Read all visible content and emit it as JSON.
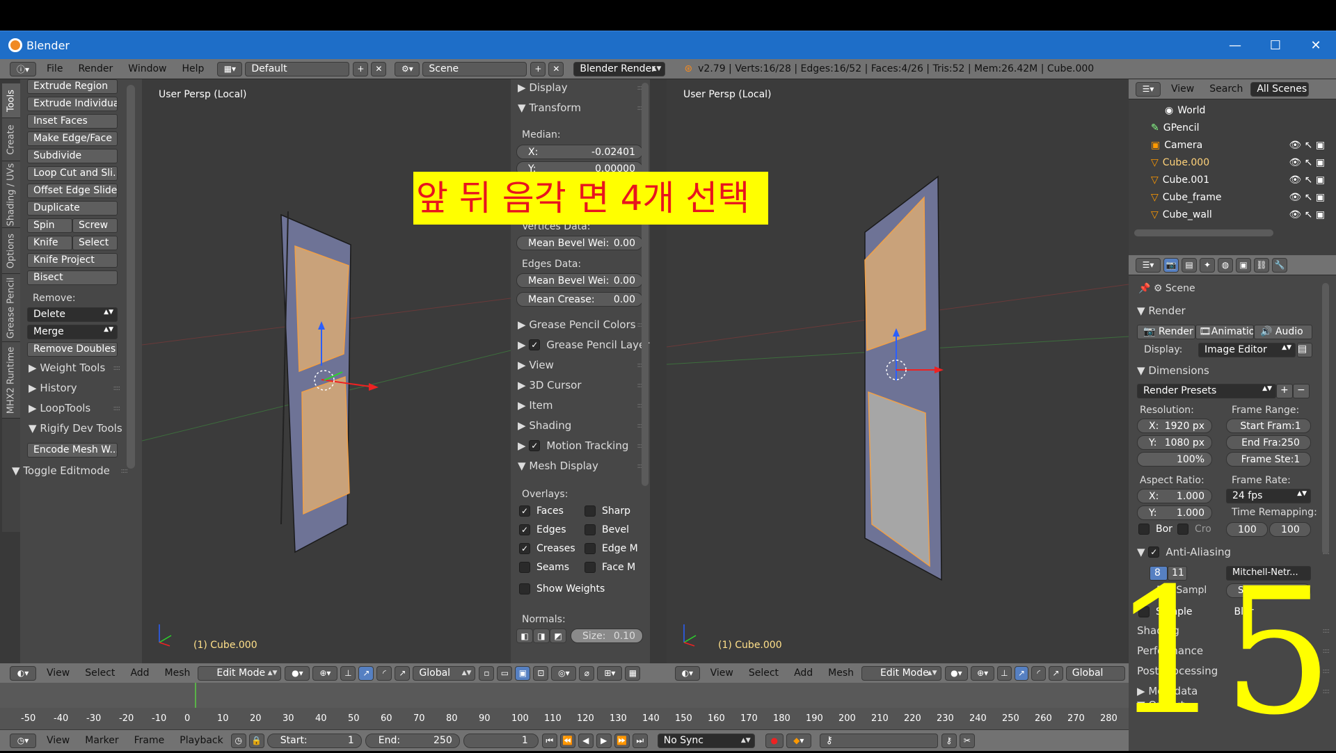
{
  "window": {
    "title": "Blender",
    "minimize": "—",
    "maximize": "☐",
    "close": "✕"
  },
  "info_header": {
    "menus": [
      "File",
      "Render",
      "Window",
      "Help"
    ],
    "layout": "Default",
    "scene": "Scene",
    "engine": "Blender Render",
    "stats": "v2.79 | Verts:16/28 | Edges:16/52 | Faces:4/26 | Tris:52 | Mem:26.42M | Cube.000"
  },
  "tool_tabs": [
    "Tools",
    "Create",
    "Shading / UVs",
    "Options",
    "Grease Pencil",
    "MHX2 Runtime"
  ],
  "tools": {
    "buttons": [
      "Extrude Region",
      "Extrude Individual",
      "Inset Faces",
      "Make Edge/Face",
      "Subdivide",
      "Loop Cut and Sli...",
      "Offset Edge Slide",
      "Duplicate"
    ],
    "spin": "Spin",
    "screw": "Screw",
    "knife": "Knife",
    "select": "Select",
    "knife_project": "Knife Project",
    "bisect": "Bisect",
    "remove_label": "Remove:",
    "delete": "Delete",
    "merge": "Merge",
    "remove_doubles": "Remove Doubles",
    "sections": [
      "Weight Tools",
      "History",
      "LoopTools",
      "Rigify Dev Tools"
    ],
    "encode": "Encode Mesh W...",
    "toggle_editmode": "Toggle Editmode"
  },
  "viewport_left": {
    "label": "User Persp (Local)",
    "object": "(1) Cube.000"
  },
  "viewport_right": {
    "label": "User Persp (Local)",
    "object": "(1) Cube.000"
  },
  "overlay_caption": "앞 뒤 음각 면 4개 선택",
  "overlay_number": "15",
  "npanel": {
    "display": "Display",
    "transform": "Transform",
    "median": "Median:",
    "x_label": "X:",
    "x_value": "-0.02401",
    "y_label": "Y:",
    "y_value": "0.00000",
    "vertices_data": "Vertices Data:",
    "mean_bevel_v": "Mean Bevel Wei:",
    "mean_bevel_v_val": "0.00",
    "edges_data": "Edges Data:",
    "mean_bevel_e": "Mean Bevel Wei:",
    "mean_bevel_e_val": "0.00",
    "mean_crease": "Mean Crease:",
    "mean_crease_val": "0.00",
    "gp_colors": "Grease Pencil Colors",
    "gp_layer": "Grease Pencil Layer",
    "view": "View",
    "cursor3d": "3D Cursor",
    "item": "Item",
    "shading": "Shading",
    "motion_tracking": "Motion Tracking",
    "mesh_display": "Mesh Display",
    "overlays": "Overlays:",
    "faces": "Faces",
    "edges": "Edges",
    "creases": "Creases",
    "seams": "Seams",
    "sharp": "Sharp",
    "bevel": "Bevel",
    "edge_m": "Edge M",
    "face_m": "Face M",
    "show_weights": "Show Weights",
    "normals": "Normals:",
    "size": "Size:",
    "size_val": "0.10"
  },
  "outliner": {
    "view": "View",
    "search": "Search",
    "filter": "All Scenes",
    "items": [
      "World",
      "GPencil",
      "Camera",
      "Cube.000",
      "Cube.001",
      "Cube_frame",
      "Cube_wall"
    ]
  },
  "properties": {
    "scene": "Scene",
    "render_section": "Render",
    "render_btn": "Render",
    "anim_btn": "Animatio",
    "audio_btn": "Audio",
    "display_label": "Display:",
    "display_value": "Image Editor",
    "dimensions": "Dimensions",
    "presets": "Render Presets",
    "resolution": "Resolution:",
    "res_x_label": "X:",
    "res_x": "1920 px",
    "res_y_label": "Y:",
    "res_y": "1080 px",
    "res_pct": "100%",
    "frame_range": "Frame Range:",
    "start": "Start Fram:1",
    "end": "End Fra:250",
    "step": "Frame Ste:1",
    "aspect": "Aspect Ratio:",
    "asp_x_label": "X:",
    "asp_x": "1.000",
    "asp_y_label": "Y:",
    "asp_y": "1.000",
    "frame_rate": "Frame Rate:",
    "fps": "24 fps",
    "time_remap": "Time Remapping:",
    "remap_old": "100",
    "remap_new": "100",
    "border": "Bor",
    "crop": "Cro",
    "anti_aliasing": "Anti-Aliasing",
    "aa_8": "8",
    "aa_11": "11",
    "filter": "Mitchell-Netr...",
    "full_sample": "Full Sampl",
    "filter_size": "Siz: 1.000 px",
    "sampled": "Sample",
    "blur": "Blur",
    "shading": "Shading",
    "performance": "Performance",
    "post_processing": "Post Processing",
    "metadata": "Metadata",
    "output": "Output"
  },
  "view3d_header": {
    "menus": [
      "View",
      "Select",
      "Add",
      "Mesh"
    ],
    "mode": "Edit Mode",
    "orientation": "Global"
  },
  "timeline": {
    "ticks": [
      "-50",
      "-40",
      "-30",
      "-20",
      "-10",
      "0",
      "10",
      "20",
      "30",
      "40",
      "50",
      "60",
      "70",
      "80",
      "90",
      "100",
      "110",
      "120",
      "130",
      "140",
      "150",
      "160",
      "170",
      "180",
      "190",
      "200",
      "210",
      "220",
      "230",
      "240",
      "250",
      "260",
      "270",
      "280"
    ],
    "menus": [
      "View",
      "Marker",
      "Frame",
      "Playback"
    ],
    "start_label": "Start:",
    "start": "1",
    "end_label": "End:",
    "end": "250",
    "current": "1",
    "sync": "No Sync"
  },
  "colors": {
    "accent_blue": "#1e6ec8",
    "selection_orange": "#f0a048",
    "caption_bg": "#ffff00",
    "caption_fg": "#e8141e",
    "number": "#ffff00"
  }
}
